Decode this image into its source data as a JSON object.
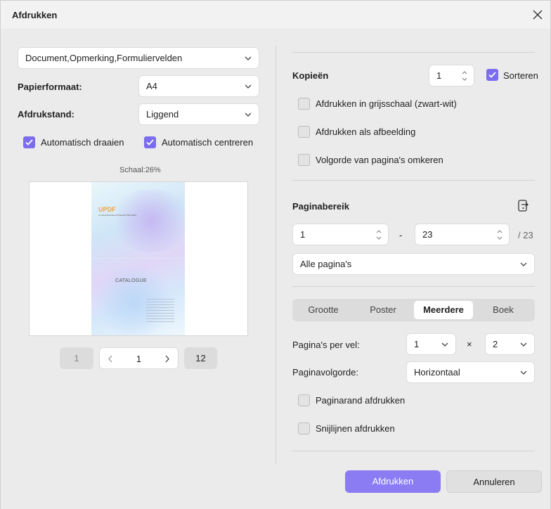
{
  "dialog": {
    "title": "Afdrukken"
  },
  "left": {
    "content_select": "Document,Opmerking,Formuliervelden",
    "paper_size": {
      "label": "Papierformaat:",
      "value": "A4"
    },
    "orientation": {
      "label": "Afdrukstand:",
      "value": "Liggend"
    },
    "auto_rotate": {
      "label": "Automatisch draaien",
      "checked": true
    },
    "auto_center": {
      "label": "Automatisch centreren",
      "checked": true
    },
    "scale": "Schaal:26%",
    "preview": {
      "logo": "UPDF",
      "subtitle": "A Comprehensive & Powerful PDF Editor",
      "catalogue": "CATALOGUE"
    },
    "pager": {
      "first": "1",
      "current": "1",
      "last": "12"
    }
  },
  "right": {
    "copies": {
      "label": "Kopieën",
      "value": "1"
    },
    "collate": {
      "label": "Sorteren",
      "checked": true
    },
    "grayscale": {
      "label": "Afdrukken in grijsschaal (zwart-wit)",
      "checked": false
    },
    "as_image": {
      "label": "Afdrukken als afbeelding",
      "checked": false
    },
    "reverse": {
      "label": "Volgorde van pagina's omkeren",
      "checked": false
    },
    "page_range": {
      "label": "Paginabereik",
      "from": "1",
      "dash": "-",
      "to": "23",
      "total": "/ 23",
      "mode": "Alle pagina's"
    },
    "tabs": [
      "Grootte",
      "Poster",
      "Meerdere",
      "Boek"
    ],
    "active_tab": "Meerdere",
    "pages_per_sheet": {
      "label": "Pagina's per vel:",
      "cols": "1",
      "times": "×",
      "rows": "2"
    },
    "page_order": {
      "label": "Paginavolgorde:",
      "value": "Horizontaal"
    },
    "print_border": {
      "label": "Paginarand afdrukken",
      "checked": false
    },
    "cut_lines": {
      "label": "Snijlijnen afdrukken",
      "checked": false
    }
  },
  "footer": {
    "print": "Afdrukken",
    "cancel": "Annuleren"
  },
  "colors": {
    "accent": "#7b6cf0",
    "primary_button": "#8b7cf3"
  }
}
